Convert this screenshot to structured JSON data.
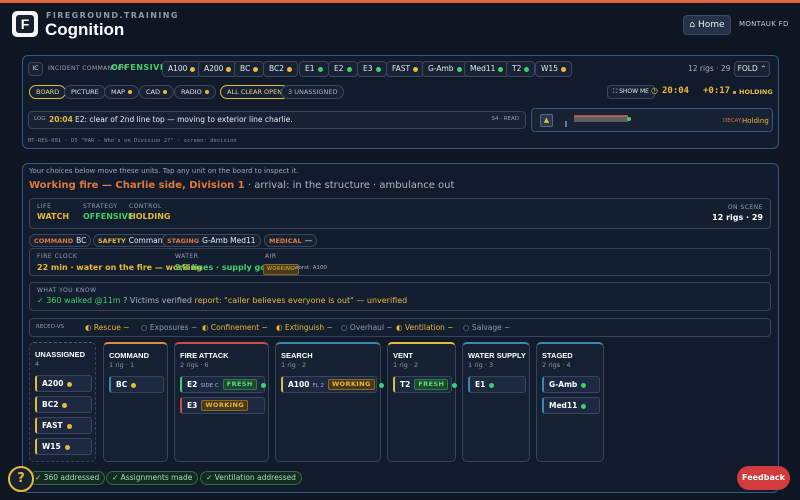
{
  "header": {
    "brand_sub": "FIREGROUND.TRAINING",
    "brand": "Cognition",
    "logo_letter": "F",
    "home_label": "⌂ Home",
    "org": "MONTAUK FD"
  },
  "command_bar": {
    "ic_tag": "IC",
    "ic_label": "INCIDENT COMMANDER",
    "mode": "OFFENSIVE",
    "units": [
      {
        "id": "A100",
        "dot": "y"
      },
      {
        "id": "A200",
        "dot": "y"
      },
      {
        "id": "BC",
        "dot": "y"
      },
      {
        "id": "BC2",
        "dot": "y"
      },
      {
        "id": "E1",
        "dot": "g"
      },
      {
        "id": "E2",
        "dot": "g"
      },
      {
        "id": "E3",
        "dot": "g"
      },
      {
        "id": "FAST",
        "dot": "y"
      },
      {
        "id": "G-Amb",
        "dot": "g"
      },
      {
        "id": "Med11",
        "dot": "g"
      },
      {
        "id": "T2",
        "dot": "g"
      },
      {
        "id": "W15",
        "dot": "y"
      }
    ],
    "rigs": "12 rigs · 29",
    "fold": "FOLD ⌃"
  },
  "tabs": [
    {
      "label": "BOARD"
    },
    {
      "label": "PICTURE"
    },
    {
      "label": "MAP"
    },
    {
      "label": "CAD"
    },
    {
      "label": "RADIO"
    }
  ],
  "all_clear": "ALL CLEAR OPEN",
  "unassigned_count": "3 UNASSIGNED",
  "show_me": "SHOW ME",
  "timer": "20:04",
  "timer_delta": "+0:17",
  "holding": "HOLDING",
  "log": {
    "tag": "LOG",
    "time": "20:04",
    "text": "E2: clear of 2nd line top — moving to exterior line charlie.",
    "meta": "S4 · READ"
  },
  "mini_status": {
    "decay": "DECAY",
    "holding": "Holding"
  },
  "debug_line": "MT-RES-001 · D5 \"PAR — Who's on Division 2?\" · screen: decision",
  "board": {
    "hint": "Your choices below move these units. Tap any unit on the board to inspect it.",
    "headline": "Working fire — Charlie side, Division 1",
    "headline_rest": " · arrival: in the structure · ambulance out",
    "status": {
      "life_cap": "LIFE",
      "life": "WATCH",
      "strategy_cap": "STRATEGY",
      "strategy": "OFFENSIVE",
      "control_cap": "CONTROL",
      "control": "HOLDING",
      "onscene_cap": "ON SCENE",
      "onscene": "12 rigs · 29"
    },
    "pills": [
      {
        "k": "COMMAND",
        "v": "BC"
      },
      {
        "k": "SAFETY",
        "v": "Command"
      },
      {
        "k": "STAGING",
        "v": "G-Amb Med11"
      },
      {
        "k": "MEDICAL",
        "v": "—"
      }
    ],
    "clock": {
      "cap": "FIRE CLOCK",
      "val": "22 min · water on the fire — working",
      "water_cap": "WATER",
      "water": "2/3 lines · supply good",
      "air_cap": "AIR",
      "air_badge": "WORKING",
      "air_worst": "worst: A100"
    },
    "know": {
      "cap": "WHAT YOU KNOW",
      "a": "✓ 360 walked @11m",
      "b": "? Victims verified",
      "c": "report: \"caller believes everyone is out\" — unverified"
    },
    "recco": {
      "tag": "RECEO-VS",
      "items": [
        "◐ Rescue ~",
        "○ Exposures ~",
        "◐ Confinement ~",
        "◐ Extinguish ~",
        "○ Overhaul ~",
        "◐ Ventilation ~",
        "○ Salvage ~"
      ]
    },
    "columns": [
      {
        "title": "UNASSIGNED",
        "sub": "4",
        "cards": [
          {
            "id": "A200",
            "dot": "y"
          },
          {
            "id": "BC2",
            "dot": "y"
          },
          {
            "id": "FAST",
            "dot": "y"
          },
          {
            "id": "W15",
            "dot": "y"
          }
        ]
      },
      {
        "title": "COMMAND",
        "sub": "1 rig · 1",
        "cards": [
          {
            "id": "BC",
            "dot": "y"
          }
        ]
      },
      {
        "title": "FIRE ATTACK",
        "sub": "2 rigs · 6",
        "cards": [
          {
            "id": "E2",
            "extra": "SIDE C",
            "badge": "FRESH",
            "dot": "g"
          },
          {
            "id": "E3",
            "badge": "WORKING",
            "dot": ""
          }
        ]
      },
      {
        "title": "SEARCH",
        "sub": "1 rig · 2",
        "cards": [
          {
            "id": "A100",
            "extra": "FL 2",
            "badge": "WORKING",
            "dot": "g"
          }
        ]
      },
      {
        "title": "VENT",
        "sub": "1 rig · 2",
        "cards": [
          {
            "id": "T2",
            "badge": "FRESH",
            "dot": "g"
          }
        ]
      },
      {
        "title": "WATER SUPPLY",
        "sub": "1 rig · 3",
        "cards": [
          {
            "id": "E1",
            "dot": "g"
          }
        ]
      },
      {
        "title": "STAGED",
        "sub": "2 rigs · 4",
        "cards": [
          {
            "id": "G-Amb",
            "dot": "g"
          },
          {
            "id": "Med11",
            "dot": "g"
          }
        ]
      }
    ]
  },
  "footer": {
    "items": [
      "✓ 360 addressed",
      "✓ Assignments made",
      "✓ Ventilation addressed"
    ],
    "help": "?",
    "feedback": "Feedback"
  },
  "colors": {
    "accent": "#e0663a",
    "go": "#3fcf6b",
    "warn": "#e8b93a",
    "panel_border": "#2f5a86"
  }
}
